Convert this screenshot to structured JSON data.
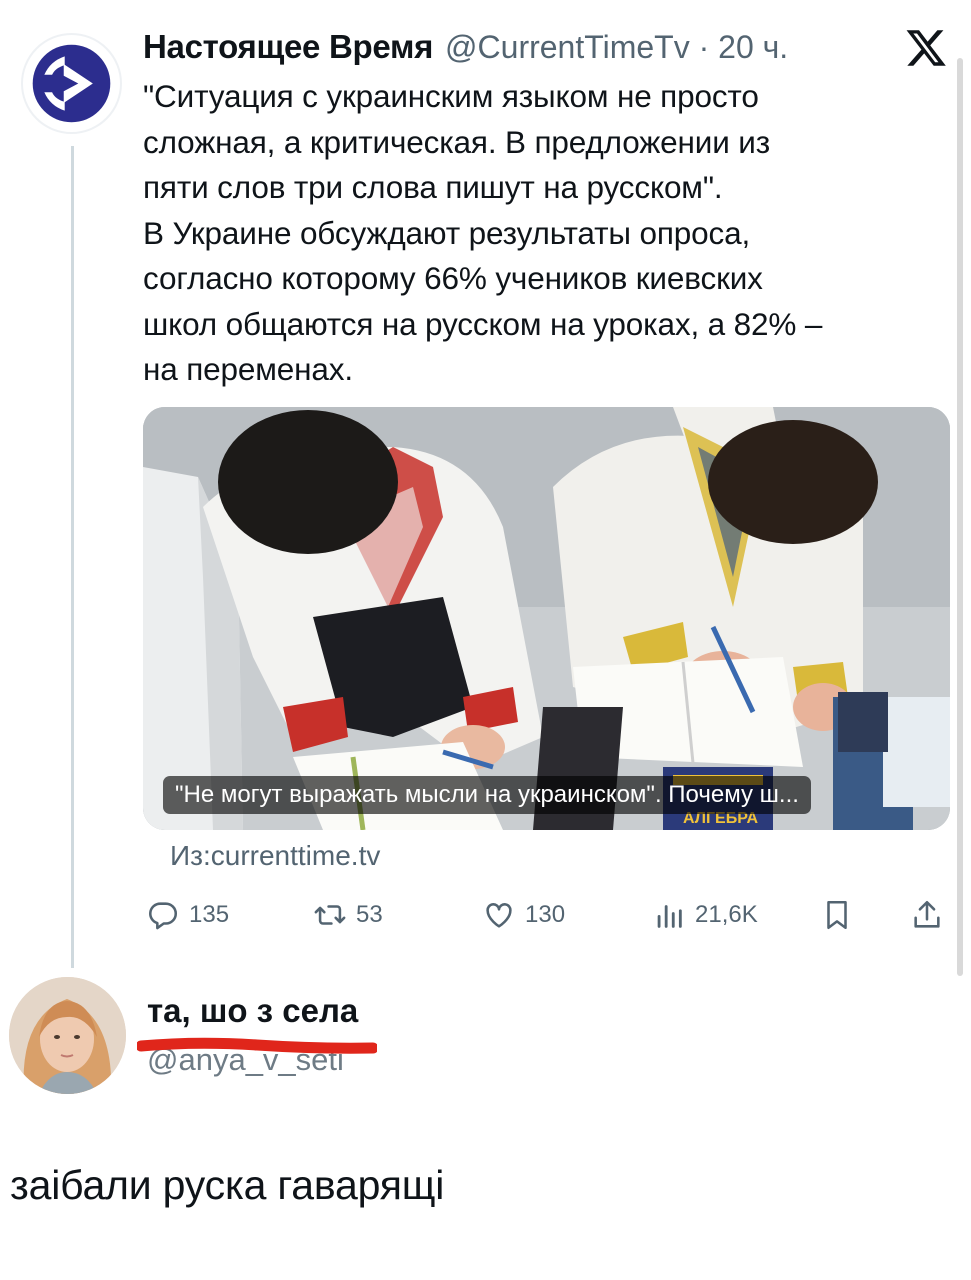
{
  "post": {
    "author_name": "Настоящее Время",
    "author_meta": "@CurrentTimeTv · 20 ч.",
    "text": "\"Ситуация с украинским языком не просто\nсложная, а критическая. В предложении из\nпяти слов три слова пишут на русском\".\nВ Украине обсуждают результаты опроса,\nсогласно которому 66% учеников киевских\nшкол общаются на русском на уроках, а 82% –\nна переменах.",
    "media_caption": "\"Не могут выражать мысли на украинском\". Почему ш...",
    "book_label": "АЛГЕБРА",
    "source_link": "Из:currenttime.tv",
    "stats": {
      "replies": "135",
      "reposts": "53",
      "likes": "130",
      "views": "21,6K"
    }
  },
  "reply": {
    "name": "та, шо з села",
    "handle": "@anya_v_seti",
    "text": "заібали руска гаварящі"
  },
  "colors": {
    "accent_blue": "#2c2d8e",
    "muted_text": "#536471",
    "red_marker": "#e0261b"
  }
}
